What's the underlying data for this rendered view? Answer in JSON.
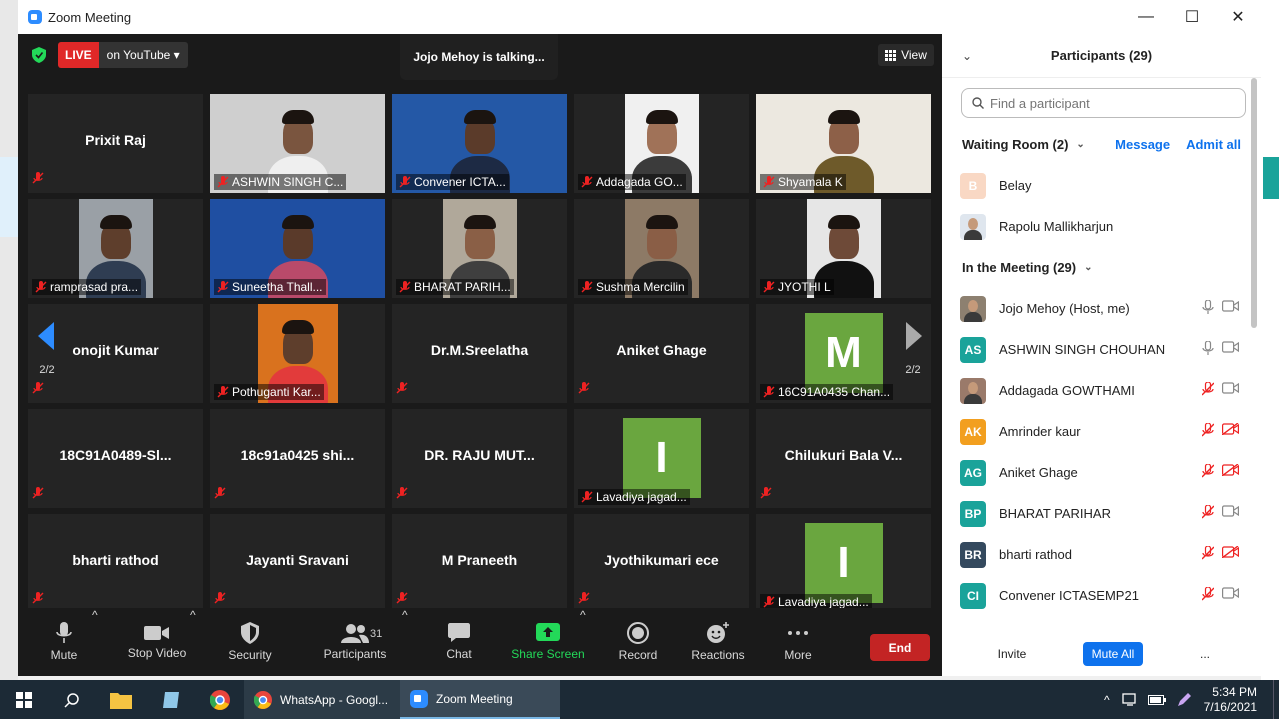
{
  "window": {
    "title": "Zoom Meeting"
  },
  "top": {
    "live_label": "LIVE",
    "stream_target": "on YouTube",
    "talking": "Jojo Mehoy is talking...",
    "view_label": "View"
  },
  "tiles": [
    {
      "id": "t0",
      "name": "Prixit Raj",
      "label": "",
      "video": false
    },
    {
      "id": "t1",
      "name": "",
      "label": "ASHWIN SINGH C...",
      "video": true
    },
    {
      "id": "t2",
      "name": "",
      "label": "Convener ICTA...",
      "video": true
    },
    {
      "id": "t3",
      "name": "",
      "label": "Addagada GO...",
      "video": true
    },
    {
      "id": "t4",
      "name": "",
      "label": "Shyamala K",
      "video": true
    },
    {
      "id": "t5",
      "name": "",
      "label": "ramprasad pra...",
      "video": true
    },
    {
      "id": "t6",
      "name": "",
      "label": "Suneetha Thall...",
      "video": true
    },
    {
      "id": "t7",
      "name": "",
      "label": "BHARAT PARIH...",
      "video": true
    },
    {
      "id": "t8",
      "name": "",
      "label": "Sushma Mercilin",
      "video": true
    },
    {
      "id": "t9",
      "name": "",
      "label": "JYOTHI L",
      "video": true
    },
    {
      "id": "t10",
      "name": "onojit Kumar",
      "label": "",
      "video": false
    },
    {
      "id": "t11",
      "name": "",
      "label": "Pothuganti Kar...",
      "video": true
    },
    {
      "id": "t12",
      "name": "Dr.M.Sreelatha",
      "label": "",
      "video": false
    },
    {
      "id": "t13",
      "name": "Aniket Ghage",
      "label": "",
      "video": false
    },
    {
      "id": "t14",
      "name": "",
      "label": "16C91A0435 Chan...",
      "video": true,
      "letter": "M"
    },
    {
      "id": "t15",
      "name": "18C91A0489-Sl...",
      "label": "",
      "video": false
    },
    {
      "id": "t16",
      "name": "18c91a0425 shi...",
      "label": "",
      "video": false
    },
    {
      "id": "t17",
      "name": "DR. RAJU MUT...",
      "label": "",
      "video": false
    },
    {
      "id": "t18",
      "name": "",
      "label": "Lavadiya jagad...",
      "video": true,
      "letter": "I"
    },
    {
      "id": "t19",
      "name": "Chilukuri Bala V...",
      "label": "",
      "video": false
    },
    {
      "id": "t20",
      "name": "bharti rathod",
      "label": "",
      "video": false
    },
    {
      "id": "t21",
      "name": "Jayanti Sravani",
      "label": "",
      "video": false
    },
    {
      "id": "t22",
      "name": "M Praneeth",
      "label": "",
      "video": false
    },
    {
      "id": "t23",
      "name": "Jyothikumari ece",
      "label": "",
      "video": false
    },
    {
      "id": "t24",
      "name": "",
      "label": "Lavadiya jagad...",
      "video": true,
      "letter": "I"
    }
  ],
  "paging": {
    "left": "2/2",
    "right": "2/2"
  },
  "toolbar": {
    "mute": "Mute",
    "stop_video": "Stop Video",
    "security": "Security",
    "participants": "Participants",
    "participants_count": "31",
    "chat": "Chat",
    "share_screen": "Share Screen",
    "record": "Record",
    "reactions": "Reactions",
    "more": "More",
    "end": "End"
  },
  "panel": {
    "title": "Participants (29)",
    "search_placeholder": "Find a participant",
    "waiting_room": "Waiting Room (2)",
    "message": "Message",
    "admit_all": "Admit all",
    "waiting": [
      {
        "name": "Belay",
        "initials": "B",
        "color": "#f9d8c4"
      },
      {
        "name": "Rapolu Mallikharjun",
        "initials": "",
        "color": "#dfe6ee"
      }
    ],
    "in_meeting": "In the Meeting (29)",
    "members": [
      {
        "name": "Jojo Mehoy (Host, me)",
        "initials": "",
        "color": "#8d8070",
        "mic": "on",
        "cam": "on"
      },
      {
        "name": "ASHWIN SINGH CHOUHAN",
        "initials": "AS",
        "color": "#1aa39a",
        "mic": "on",
        "cam": "on"
      },
      {
        "name": "Addagada GOWTHAMI",
        "initials": "",
        "color": "#9a7a6a",
        "mic": "off",
        "cam": "on"
      },
      {
        "name": "Amrinder kaur",
        "initials": "AK",
        "color": "#f29f1f",
        "mic": "off",
        "cam": "off"
      },
      {
        "name": "Aniket Ghage",
        "initials": "AG",
        "color": "#1aa39a",
        "mic": "off",
        "cam": "off"
      },
      {
        "name": "BHARAT PARIHAR",
        "initials": "BP",
        "color": "#1aa39a",
        "mic": "off",
        "cam": "on"
      },
      {
        "name": "bharti rathod",
        "initials": "BR",
        "color": "#34495e",
        "mic": "off",
        "cam": "off"
      },
      {
        "name": "Convener ICTASEMP21",
        "initials": "CI",
        "color": "#1aa39a",
        "mic": "off",
        "cam": "on"
      }
    ],
    "invite": "Invite",
    "mute_all": "Mute All",
    "more": "..."
  },
  "taskbar": {
    "whatsapp": "WhatsApp - Googl...",
    "zoom": "Zoom Meeting",
    "time": "5:34 PM",
    "date": "7/16/2021"
  }
}
